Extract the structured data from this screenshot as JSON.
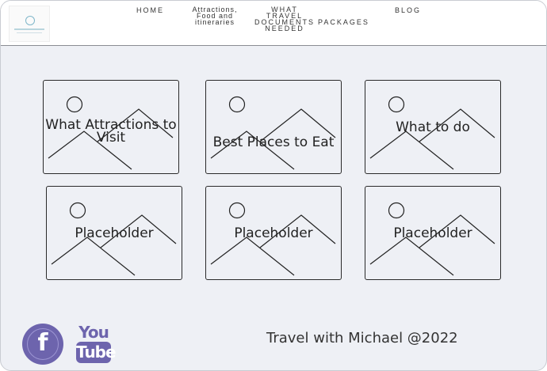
{
  "header": {
    "nav": {
      "home": "HOME",
      "attractions": "Attractions, Food and itineraries",
      "documents": "WHAT TRAVEL DOCUMENTS NEEDED",
      "packages": "PACKAGES",
      "blog": "BLOG"
    }
  },
  "cards": [
    {
      "label": "What Attractions to Visit"
    },
    {
      "label": "Best Places to Eat"
    },
    {
      "label": "What to do"
    },
    {
      "label": "Placeholder"
    },
    {
      "label": "Placeholder"
    },
    {
      "label": "Placeholder"
    }
  ],
  "footer": {
    "facebook_icon": "facebook-icon",
    "youtube_icon": "youtube-icon",
    "youtube_you": "You",
    "youtube_tube": "Tube",
    "copyright": "Travel with Michael @2022",
    "social_color": "#6d64ad"
  }
}
